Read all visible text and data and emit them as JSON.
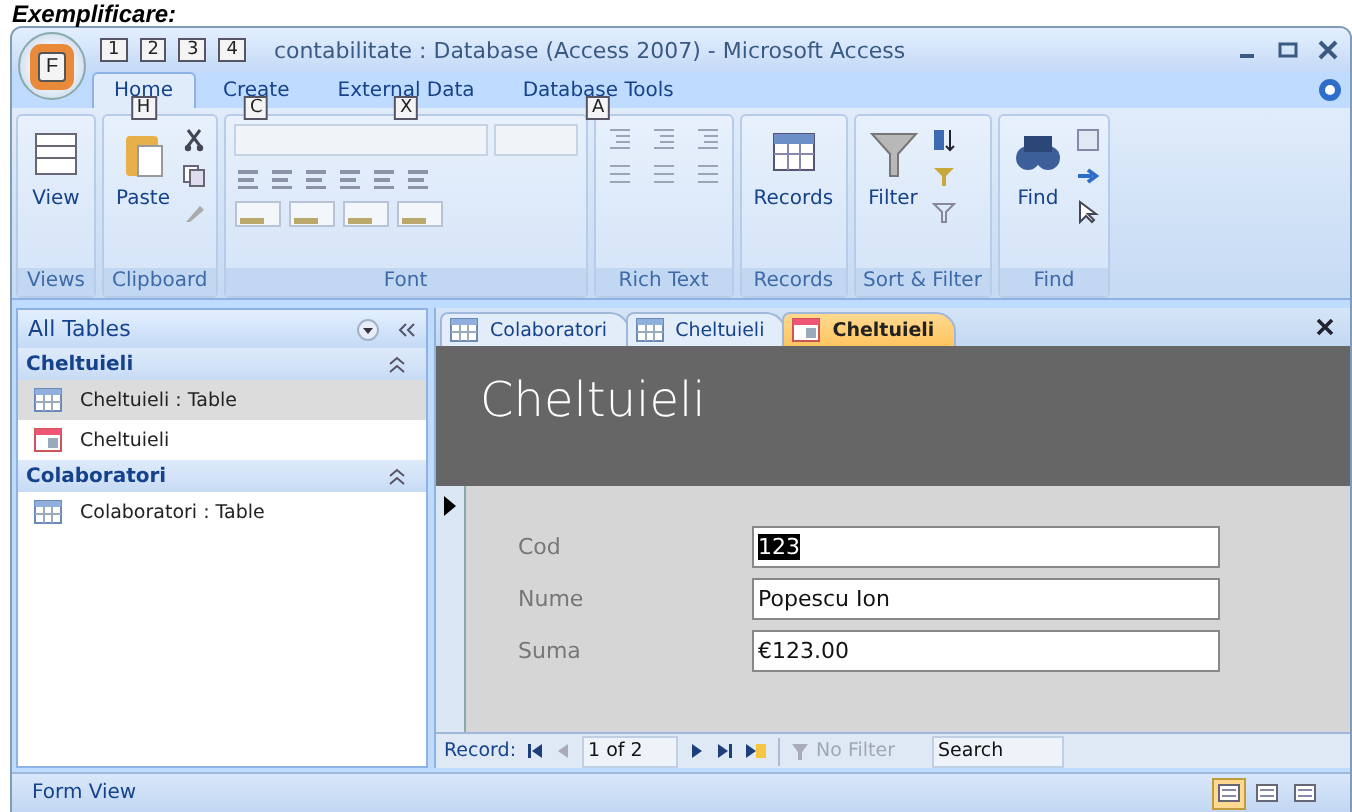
{
  "caption": "Exemplificare:",
  "window": {
    "title": "contabilitate : Database (Access 2007) - Microsoft Access",
    "office_keytip": "F",
    "quick_access_keytips": [
      "1",
      "2",
      "3",
      "4"
    ]
  },
  "ribbon_tabs": [
    {
      "label": "Home",
      "keytip": "H",
      "selected": true
    },
    {
      "label": "Create",
      "keytip": "C",
      "selected": false
    },
    {
      "label": "External Data",
      "keytip": "X",
      "selected": false
    },
    {
      "label": "Database Tools",
      "keytip": "A",
      "selected": false
    }
  ],
  "ribbon_groups": [
    {
      "title": "Views",
      "kind": "buttons",
      "buttons": [
        "View"
      ]
    },
    {
      "title": "Clipboard",
      "kind": "buttons",
      "buttons": [
        "Paste"
      ]
    },
    {
      "title": "Font",
      "kind": "font"
    },
    {
      "title": "Rich Text",
      "kind": "rich_text"
    },
    {
      "title": "Records",
      "kind": "buttons",
      "buttons": [
        "Records"
      ]
    },
    {
      "title": "Sort & Filter",
      "kind": "buttons",
      "buttons": [
        "Filter"
      ]
    },
    {
      "title": "Find",
      "kind": "buttons",
      "buttons": [
        "Find"
      ]
    }
  ],
  "nav_pane": {
    "title": "All Tables",
    "groups": [
      {
        "title": "Cheltuieli",
        "items": [
          {
            "kind": "table",
            "label": "Cheltuieli : Table",
            "selected": true
          },
          {
            "kind": "form",
            "label": "Cheltuieli",
            "selected": false
          }
        ]
      },
      {
        "title": "Colaboratori",
        "items": [
          {
            "kind": "table",
            "label": "Colaboratori : Table",
            "selected": false
          }
        ]
      }
    ]
  },
  "doc_tabs": [
    {
      "kind": "table",
      "label": "Colaboratori",
      "selected": false
    },
    {
      "kind": "table",
      "label": "Cheltuieli",
      "selected": false
    },
    {
      "kind": "form",
      "label": "Cheltuieli",
      "selected": true
    }
  ],
  "form": {
    "title": "Cheltuieli",
    "fields": [
      {
        "label": "Cod",
        "value": "123",
        "selected": true
      },
      {
        "label": "Nume",
        "value": "Popescu Ion",
        "selected": false
      },
      {
        "label": "Suma",
        "value": "€123.00",
        "selected": false
      }
    ]
  },
  "record_nav": {
    "label": "Record:",
    "position": "1 of 2",
    "filter": "No Filter",
    "search": "Search"
  },
  "status_bar": {
    "text": "Form View",
    "views": [
      {
        "selected": true
      },
      {
        "selected": false
      },
      {
        "selected": false
      }
    ]
  }
}
